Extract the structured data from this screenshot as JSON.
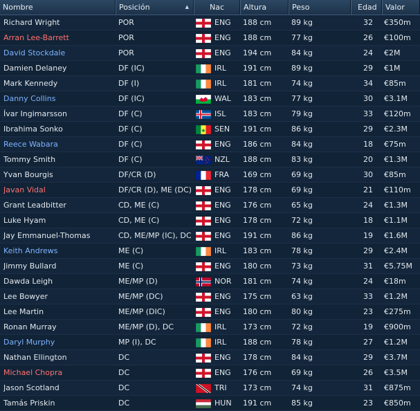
{
  "columns": {
    "name": "Nombre",
    "position": "Posición",
    "nationality": "Nac",
    "height": "Altura",
    "weight": "Peso",
    "age": "Edad",
    "value": "Valor"
  },
  "sort": {
    "column": "position",
    "direction": "ascending",
    "icon": "sort-ascending-icon"
  },
  "name_colors": {
    "white": "#e3e8ee",
    "red": "#ff7272",
    "blue": "#7fb3ff"
  },
  "players": [
    {
      "name": "Richard Wright",
      "name_color": "white",
      "position": "POR",
      "flag": "england",
      "nat": "ENG",
      "height": "188 cm",
      "weight": "89 kg",
      "age": "32",
      "value": "€350m"
    },
    {
      "name": "Arran Lee-Barrett",
      "name_color": "red",
      "position": "POR",
      "flag": "england",
      "nat": "ENG",
      "height": "188 cm",
      "weight": "77 kg",
      "age": "26",
      "value": "€100m"
    },
    {
      "name": "David Stockdale",
      "name_color": "blue",
      "position": "POR",
      "flag": "england",
      "nat": "ENG",
      "height": "194 cm",
      "weight": "84 kg",
      "age": "24",
      "value": "€2M"
    },
    {
      "name": "Damien Delaney",
      "name_color": "white",
      "position": "DF (IC)",
      "flag": "ireland",
      "nat": "IRL",
      "height": "191 cm",
      "weight": "89 kg",
      "age": "29",
      "value": "€1M"
    },
    {
      "name": "Mark Kennedy",
      "name_color": "white",
      "position": "DF (I)",
      "flag": "ireland",
      "nat": "IRL",
      "height": "181 cm",
      "weight": "74 kg",
      "age": "34",
      "value": "€85m"
    },
    {
      "name": "Danny Collins",
      "name_color": "blue",
      "position": "DF (IC)",
      "flag": "wales",
      "nat": "WAL",
      "height": "183 cm",
      "weight": "77 kg",
      "age": "30",
      "value": "€3.1M"
    },
    {
      "name": "Ívar Ingimarsson",
      "name_color": "white",
      "position": "DF (C)",
      "flag": "iceland",
      "nat": "ISL",
      "height": "183 cm",
      "weight": "79 kg",
      "age": "33",
      "value": "€120m"
    },
    {
      "name": "Ibrahima Sonko",
      "name_color": "white",
      "position": "DF (C)",
      "flag": "senegal",
      "nat": "SEN",
      "height": "191 cm",
      "weight": "86 kg",
      "age": "29",
      "value": "€2.3M"
    },
    {
      "name": "Reece Wabara",
      "name_color": "blue",
      "position": "DF (C)",
      "flag": "england",
      "nat": "ENG",
      "height": "186 cm",
      "weight": "84 kg",
      "age": "18",
      "value": "€75m"
    },
    {
      "name": "Tommy Smith",
      "name_color": "white",
      "position": "DF (C)",
      "flag": "newzealand",
      "nat": "NZL",
      "height": "188 cm",
      "weight": "83 kg",
      "age": "20",
      "value": "€1.3M"
    },
    {
      "name": "Yvan Bourgis",
      "name_color": "white",
      "position": "DF/CR (D)",
      "flag": "france",
      "nat": "FRA",
      "height": "169 cm",
      "weight": "69 kg",
      "age": "30",
      "value": "€85m"
    },
    {
      "name": "Javan Vidal",
      "name_color": "red",
      "position": "DF/CR (D), ME (DC)",
      "flag": "england",
      "nat": "ENG",
      "height": "178 cm",
      "weight": "69 kg",
      "age": "21",
      "value": "€110m"
    },
    {
      "name": "Grant Leadbitter",
      "name_color": "white",
      "position": "CD, ME (C)",
      "flag": "england",
      "nat": "ENG",
      "height": "176 cm",
      "weight": "65 kg",
      "age": "24",
      "value": "€1.3M"
    },
    {
      "name": "Luke Hyam",
      "name_color": "white",
      "position": "CD, ME (C)",
      "flag": "england",
      "nat": "ENG",
      "height": "178 cm",
      "weight": "72 kg",
      "age": "18",
      "value": "€1.1M"
    },
    {
      "name": "Jay Emmanuel-Thomas",
      "name_color": "white",
      "position": "CD, ME/MP (IC), DC",
      "flag": "england",
      "nat": "ENG",
      "height": "191 cm",
      "weight": "86 kg",
      "age": "19",
      "value": "€1.6M"
    },
    {
      "name": "Keith Andrews",
      "name_color": "blue",
      "position": "ME (C)",
      "flag": "ireland",
      "nat": "IRL",
      "height": "183 cm",
      "weight": "78 kg",
      "age": "29",
      "value": "€2.4M"
    },
    {
      "name": "Jimmy Bullard",
      "name_color": "white",
      "position": "ME (C)",
      "flag": "england",
      "nat": "ENG",
      "height": "180 cm",
      "weight": "73 kg",
      "age": "31",
      "value": "€5.75M"
    },
    {
      "name": "Dawda Leigh",
      "name_color": "white",
      "position": "ME/MP (D)",
      "flag": "norway",
      "nat": "NOR",
      "height": "181 cm",
      "weight": "74 kg",
      "age": "24",
      "value": "€18m"
    },
    {
      "name": "Lee Bowyer",
      "name_color": "white",
      "position": "ME/MP (DC)",
      "flag": "england",
      "nat": "ENG",
      "height": "175 cm",
      "weight": "63 kg",
      "age": "33",
      "value": "€1.2M"
    },
    {
      "name": "Lee Martin",
      "name_color": "white",
      "position": "ME/MP (DIC)",
      "flag": "england",
      "nat": "ENG",
      "height": "180 cm",
      "weight": "80 kg",
      "age": "23",
      "value": "€275m"
    },
    {
      "name": "Ronan Murray",
      "name_color": "white",
      "position": "ME/MP (D), DC",
      "flag": "ireland",
      "nat": "IRL",
      "height": "173 cm",
      "weight": "72 kg",
      "age": "19",
      "value": "€900m"
    },
    {
      "name": "Daryl Murphy",
      "name_color": "blue",
      "position": "MP (I), DC",
      "flag": "ireland",
      "nat": "IRL",
      "height": "188 cm",
      "weight": "78 kg",
      "age": "27",
      "value": "€1.2M"
    },
    {
      "name": "Nathan Ellington",
      "name_color": "white",
      "position": "DC",
      "flag": "england",
      "nat": "ENG",
      "height": "178 cm",
      "weight": "84 kg",
      "age": "29",
      "value": "€3.7M"
    },
    {
      "name": "Michael Chopra",
      "name_color": "red",
      "position": "DC",
      "flag": "england",
      "nat": "ENG",
      "height": "176 cm",
      "weight": "69 kg",
      "age": "26",
      "value": "€3.5M"
    },
    {
      "name": "Jason Scotland",
      "name_color": "white",
      "position": "DC",
      "flag": "trinidad",
      "nat": "TRI",
      "height": "173 cm",
      "weight": "74 kg",
      "age": "31",
      "value": "€875m"
    },
    {
      "name": "Tamás Priskin",
      "name_color": "white",
      "position": "DC",
      "flag": "hungary",
      "nat": "HUN",
      "height": "191 cm",
      "weight": "85 kg",
      "age": "23",
      "value": "€850m"
    }
  ]
}
